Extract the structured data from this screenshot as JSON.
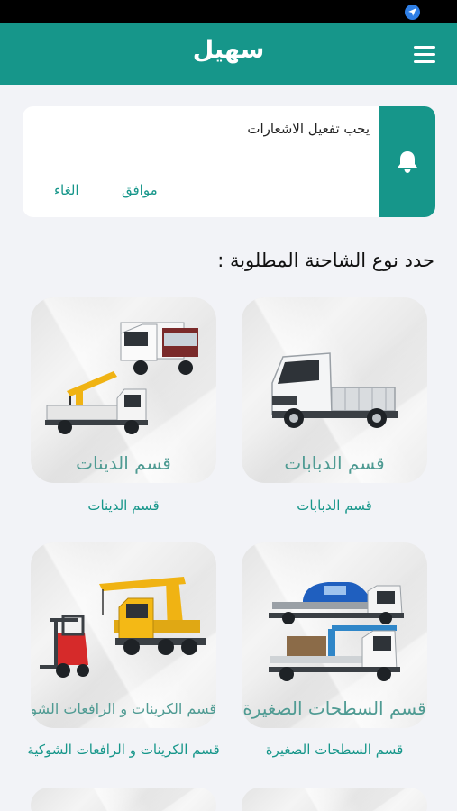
{
  "header": {
    "title": "سهيل",
    "menu_icon": "menu-icon"
  },
  "notification": {
    "message": "يجب تفعيل الاشعارات",
    "accept_label": "موافق",
    "cancel_label": "الغاء",
    "icon": "bell-icon"
  },
  "section_title": "حدد نوع الشاحنة المطلوبة :",
  "categories": [
    {
      "caption": "قسم الدبابات",
      "label": "قسم الدبابات"
    },
    {
      "caption": "قسم الدينات",
      "label": "قسم الدينات"
    },
    {
      "caption": "قسم السطحات الصغيرة",
      "label": "قسم السطحات الصغيرة"
    },
    {
      "caption": "قسم الكرينات و الرافعات الشوكية",
      "label": "قسم الكرينات و الرافعات الشوكية"
    }
  ],
  "colors": {
    "primary": "#16968a",
    "background": "#f2f3f7",
    "caption": "#4f9b93"
  }
}
